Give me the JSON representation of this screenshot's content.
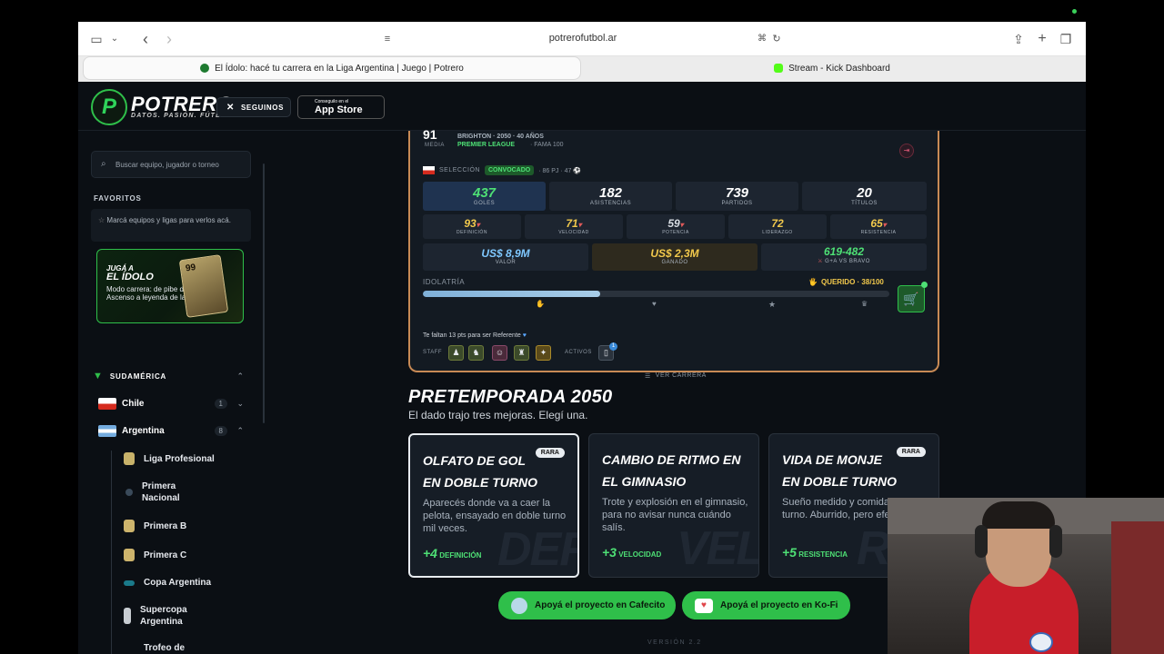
{
  "browser": {
    "url": "potrerofutbol.ar",
    "tabs": [
      {
        "title": "El Ídolo: hacé tu carrera en la Liga Argentina | Juego | Potrero",
        "active": true
      },
      {
        "title": "Stream - Kick Dashboard",
        "active": false
      }
    ]
  },
  "header": {
    "logo_mark": "P",
    "logo_text": "POTRERO",
    "tagline": "DATOS. PASIÓN. FÚTBOL.",
    "follow_label": "SEGUINOS",
    "appstore_small": "Conseguilo en el",
    "appstore_big": "App Store"
  },
  "sidebar": {
    "search_placeholder": "Buscar equipo, jugador o torneo",
    "favorites_title": "FAVORITOS",
    "favorites_hint": "Marcá equipos y ligas para verlos acá.",
    "promo": {
      "kicker": "JUGÁ A",
      "title": "EL ÍDOLO",
      "text": "Modo carrera: de pibe del Ascenso a leyenda de la Liga",
      "card_value": "99"
    },
    "region": "SUDAMÉRICA",
    "countries": [
      {
        "name": "Chile",
        "count": "1"
      },
      {
        "name": "Argentina",
        "count": "8"
      }
    ],
    "leagues": [
      "Liga Profesional",
      "Primera Nacional",
      "Primera B",
      "Primera C",
      "Copa Argentina",
      "Supercopa Argentina",
      "Trofeo de Campeones"
    ]
  },
  "player": {
    "media_label": "MEDIA",
    "bio": "BRIGHTON · 2050 · 40 AÑOS",
    "league": "PREMIER LEAGUE",
    "fame": "· FAMA 100",
    "national_label": "SELECCIÓN",
    "national_status": "CONVOCADO",
    "national_stats": "· 86 PJ · 47 ⚽",
    "stats": [
      {
        "value": "437",
        "label": "GOLES"
      },
      {
        "value": "182",
        "label": "ASISTENCIAS"
      },
      {
        "value": "739",
        "label": "PARTIDOS"
      },
      {
        "value": "20",
        "label": "TÍTULOS"
      }
    ],
    "attributes": [
      {
        "value": "93",
        "label": "DEFINICIÓN",
        "trend": "▾"
      },
      {
        "value": "71",
        "label": "VELOCIDAD",
        "trend": "▾"
      },
      {
        "value": "59",
        "label": "POTENCIA",
        "trend": "▾"
      },
      {
        "value": "72",
        "label": "LIDERAZGO",
        "trend": ""
      },
      {
        "value": "65",
        "label": "RESISTENCIA",
        "trend": "▾"
      }
    ],
    "finance": [
      {
        "value": "US$ 8,9M",
        "label": "VALOR"
      },
      {
        "value": "US$ 2,3M",
        "label": "GANADO"
      },
      {
        "value": "619-482",
        "label": "G+A VS BRAVO",
        "prefix": "⚔"
      }
    ],
    "idolatry_label": "IDOLATRÍA",
    "idolatry_status": "QUERIDO · 38/100",
    "idolatry_progress": 0.38,
    "next_level_text": "Te faltan 13 pts para ser Referente",
    "staff_label": "STAFF",
    "assets_label": "ACTIVOS",
    "assets_count": "1",
    "career_link": "VER CARRERA"
  },
  "preseason": {
    "title": "PRETEMPORADA 2050",
    "subtitle": "El dado trajo tres mejoras. Elegí una.",
    "options": [
      {
        "title": "OLFATO DE GOL EN DOBLE TURNO",
        "badge": "RARA",
        "desc": "Aparecés donde va a caer la pelota, ensayado en doble turno mil veces.",
        "gain": "+4",
        "attr": "DEFINICIÓN",
        "ghost": "DEF"
      },
      {
        "title": "CAMBIO DE RITMO EN EL GIMNASIO",
        "badge": "",
        "desc": "Trote y explosión en el gimnasio, para no avisar nunca cuándo salís.",
        "gain": "+3",
        "attr": "VELOCIDAD",
        "ghost": "VEL"
      },
      {
        "title": "VIDA DE MONJE EN DOBLE TURNO",
        "badge": "RARA",
        "desc": "Sueño medido y comida en doble turno. Aburrido, pero efectivo.",
        "gain": "+5",
        "attr": "RESISTENCIA",
        "ghost": "RES"
      }
    ]
  },
  "support": {
    "cafecito": "Apoyá el proyecto en Cafecito",
    "kofi": "Apoyá el proyecto en Ko-Fi"
  },
  "version": "VERSIÓN 2.2",
  "colors": {
    "accent": "#2fbf4a",
    "card_border": "#c88a55",
    "background": "#0b0f14"
  }
}
